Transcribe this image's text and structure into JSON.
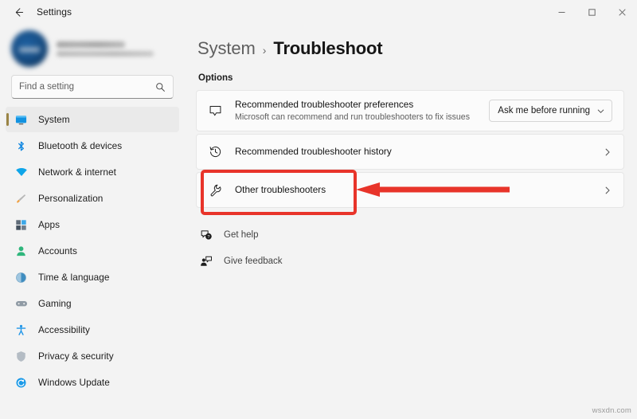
{
  "window": {
    "app_title": "Settings",
    "back_icon": "back-arrow-icon",
    "controls": {
      "minimize": "minimize-icon",
      "maximize": "maximize-icon",
      "close": "close-icon"
    }
  },
  "sidebar": {
    "profile": {
      "avatar": "user-avatar",
      "name": "",
      "email": "",
      "blurred": true
    },
    "search": {
      "placeholder": "Find a setting",
      "value": "",
      "icon": "search-icon"
    },
    "items": [
      {
        "label": "System",
        "icon": "monitor-icon",
        "selected": true
      },
      {
        "label": "Bluetooth & devices",
        "icon": "bluetooth-icon",
        "selected": false
      },
      {
        "label": "Network & internet",
        "icon": "wifi-icon",
        "selected": false
      },
      {
        "label": "Personalization",
        "icon": "paintbrush-icon",
        "selected": false
      },
      {
        "label": "Apps",
        "icon": "apps-grid-icon",
        "selected": false
      },
      {
        "label": "Accounts",
        "icon": "person-icon",
        "selected": false
      },
      {
        "label": "Time & language",
        "icon": "clock-globe-icon",
        "selected": false
      },
      {
        "label": "Gaming",
        "icon": "gamepad-icon",
        "selected": false
      },
      {
        "label": "Accessibility",
        "icon": "accessibility-person-icon",
        "selected": false
      },
      {
        "label": "Privacy & security",
        "icon": "shield-icon",
        "selected": false
      },
      {
        "label": "Windows Update",
        "icon": "update-refresh-icon",
        "selected": false
      }
    ]
  },
  "main": {
    "breadcrumb": {
      "parent": "System",
      "separator": "›",
      "current": "Troubleshoot"
    },
    "section_label": "Options",
    "cards": [
      {
        "title": "Recommended troubleshooter preferences",
        "subtitle": "Microsoft can recommend and run troubleshooters to fix issues",
        "icon": "chat-bubble-icon",
        "control": "dropdown",
        "dropdown_value": "Ask me before running"
      },
      {
        "title": "Recommended troubleshooter history",
        "subtitle": "",
        "icon": "history-clock-icon",
        "control": "chevron",
        "dropdown_value": ""
      },
      {
        "title": "Other troubleshooters",
        "subtitle": "",
        "icon": "wrench-icon",
        "control": "chevron",
        "dropdown_value": "",
        "highlighted": true
      }
    ],
    "links": [
      {
        "label": "Get help",
        "icon": "help-question-icon"
      },
      {
        "label": "Give feedback",
        "icon": "feedback-icon"
      }
    ]
  },
  "annotations": {
    "highlight_color": "#e8342a",
    "arrow_color": "#e8342a",
    "target": "Other troubleshooters"
  },
  "watermark": "wsxdn.com"
}
